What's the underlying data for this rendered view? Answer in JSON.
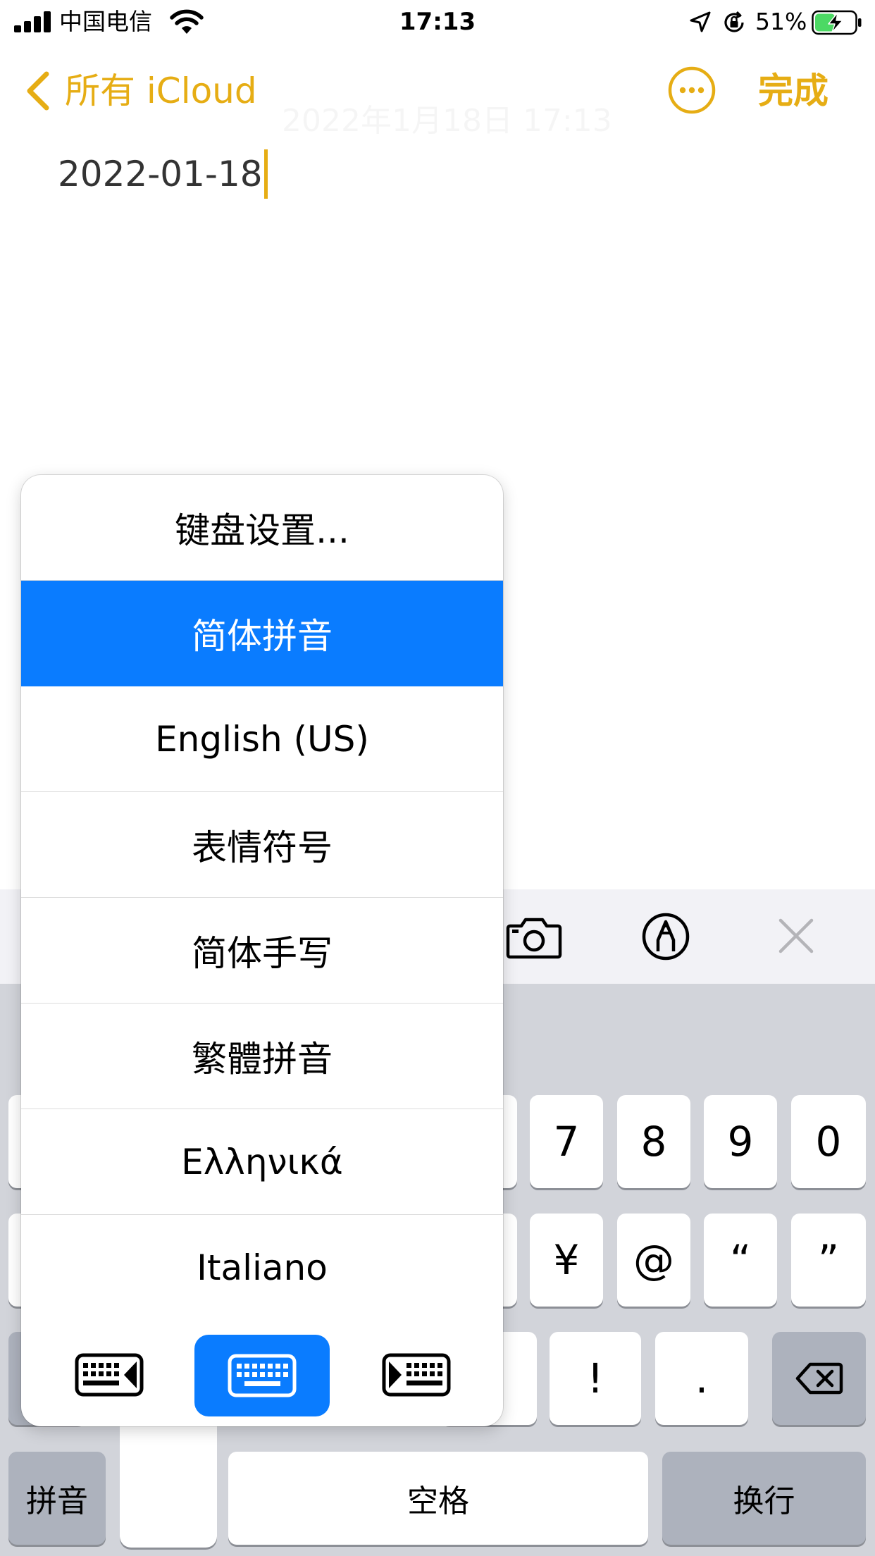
{
  "status_bar": {
    "carrier": "中国电信",
    "time": "17:13",
    "battery_percent": "51%",
    "battery_level": 0.51,
    "icons": [
      "signal-icon",
      "wifi-icon",
      "location-icon",
      "orientation-lock-icon",
      "battery-charging-icon"
    ]
  },
  "nav": {
    "back_label": "所有 iCloud",
    "done_label": "完成",
    "more_icon": "ellipsis-circle-icon",
    "faded_date": "2022年1月18日 17:13"
  },
  "note": {
    "text": "2022-01-18"
  },
  "toolbar": {
    "icons": [
      "camera-icon",
      "markup-icon",
      "close-icon"
    ]
  },
  "keyboard": {
    "row1": [
      "7",
      "8",
      "9",
      "0"
    ],
    "row2": [
      "¥",
      "@",
      "“",
      "”"
    ],
    "row3": [
      "!",
      "."
    ],
    "pinyin_label": "拼音",
    "space_label": "空格",
    "return_label": "换行",
    "delete_icon": "backspace-icon"
  },
  "popup": {
    "items": [
      {
        "label": "键盘设置...",
        "selected": false
      },
      {
        "label": "简体拼音",
        "selected": true
      },
      {
        "label": "English (US)",
        "selected": false
      },
      {
        "label": "表情符号",
        "selected": false
      },
      {
        "label": "简体手写",
        "selected": false
      },
      {
        "label": "繁體拼音",
        "selected": false
      },
      {
        "label": "Ελληνικά",
        "selected": false
      },
      {
        "label": "Italiano",
        "selected": false
      }
    ],
    "footer_icons": [
      "keyboard-left-icon",
      "keyboard-full-icon",
      "keyboard-right-icon"
    ]
  },
  "colors": {
    "accent": "#e6ad14",
    "selection_blue": "#0a7cff",
    "keyboard_bg": "#d2d4da",
    "toolbar_bg": "#f2f2f6"
  }
}
